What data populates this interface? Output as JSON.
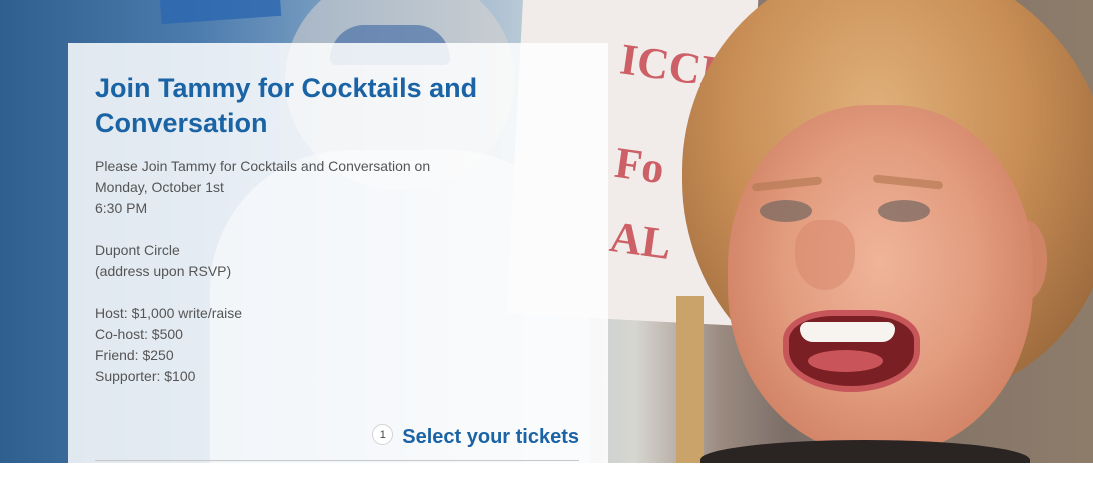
{
  "event": {
    "title": "Join Tammy for Cocktails and Conversation",
    "details": "Please Join Tammy for Cocktails and Conversation on\nMonday, October 1st\n6:30 PM\n\nDupont Circle\n(address upon RSVP)\n\nHost: $1,000 write/raise\nCo-host: $500\nFriend: $250\nSupporter: $100"
  },
  "tickets": {
    "step_number": "1",
    "step_label": "Select your tickets"
  },
  "colors": {
    "accent": "#1a63a4",
    "body_text": "#555555"
  }
}
